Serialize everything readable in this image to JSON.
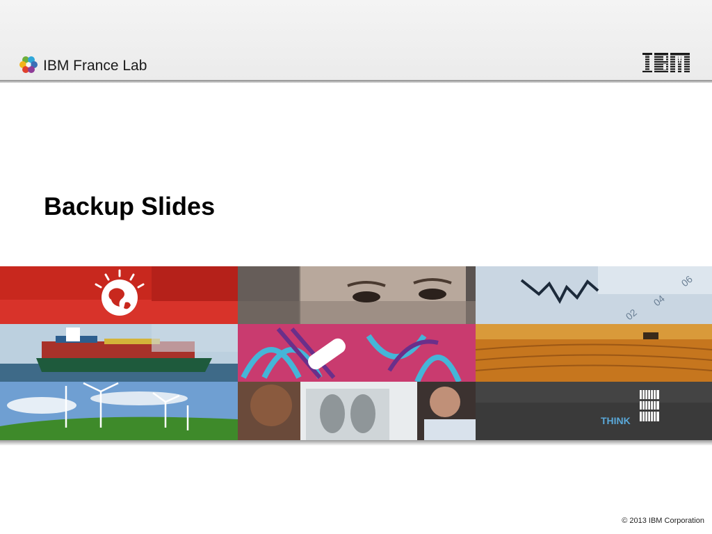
{
  "header": {
    "lab_name": "IBM France Lab",
    "lab_logo_icon": "colored-dots-icon",
    "brand_logo": "IBM"
  },
  "slide": {
    "title": "Backup Slides"
  },
  "mosaic": {
    "think_text": "THINK",
    "tiles": [
      "smarter-planet-globe-tile",
      "child-eyes-tile",
      "stock-chart-tile",
      "container-ship-tile",
      "abstract-pattern-tile",
      "wheat-field-tile",
      "wind-turbines-tile",
      "doctors-xray-tile",
      "think-ibm-tile"
    ]
  },
  "footer": {
    "copyright": "© 2013 IBM Corporation"
  },
  "colors": {
    "accent_red": "#c8281e",
    "header_bg": "#efefef",
    "title_text": "#000000"
  }
}
